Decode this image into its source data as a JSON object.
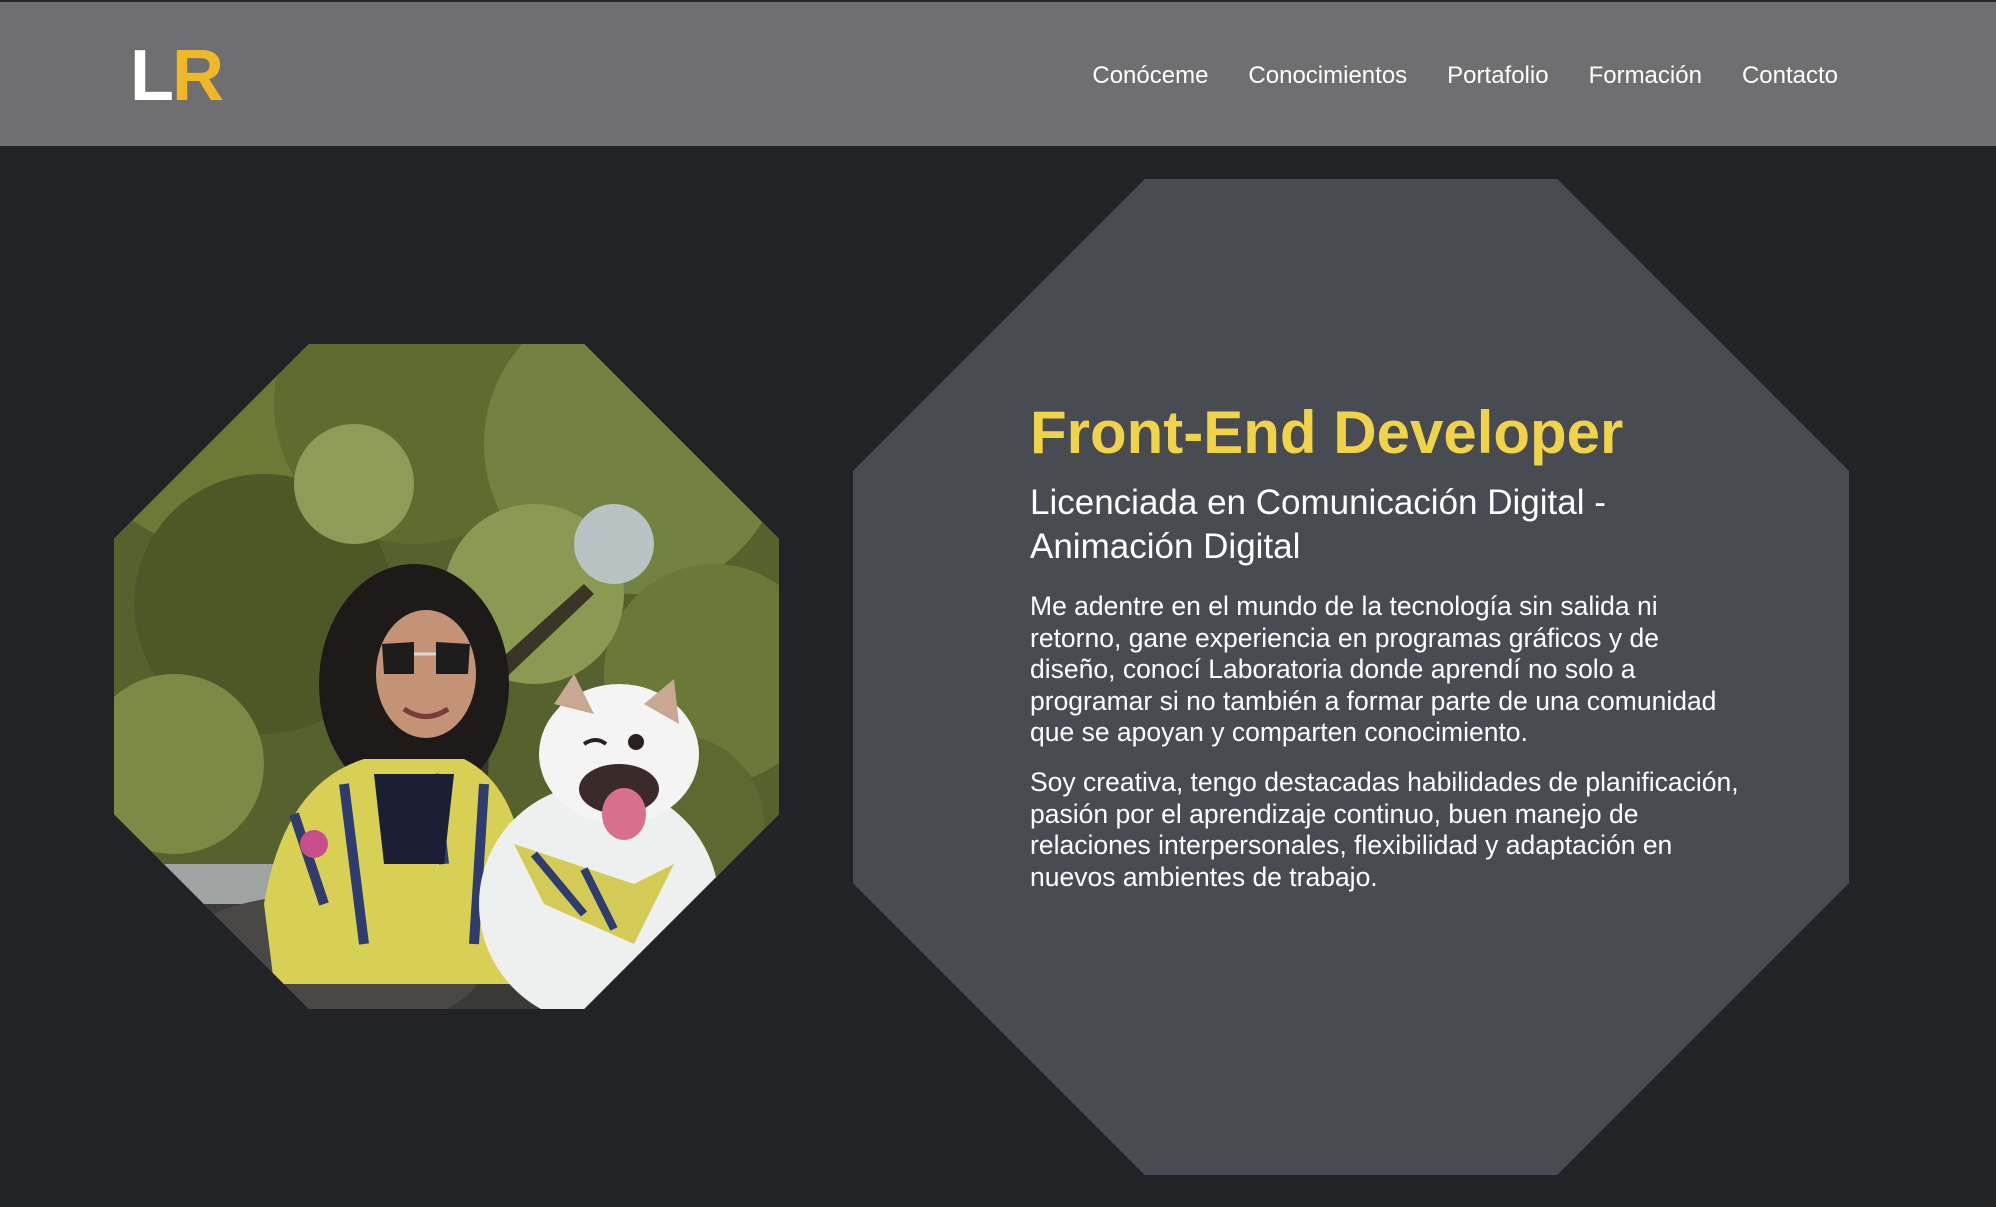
{
  "nav": {
    "logo_first": "L",
    "logo_second": "R",
    "links": [
      "Conóceme",
      "Conocimientos",
      "Portafolio",
      "Formación",
      "Contacto"
    ]
  },
  "hero": {
    "title": "Front-End Developer",
    "subtitle": "Licenciada en Comunicación Digital - Animación Digital",
    "paragraphs": [
      "Me adentre en el mundo de la tecnología sin salida ni retorno, gane experiencia en programas gráficos y de diseño, conocí Laboratoria donde aprendí no solo a programar si no también a formar parte de una comunidad que se apoyan y comparten conocimiento.",
      "Soy creativa, tengo destacadas habilidades de planificación, pasión por el aprendizaje continuo, buen manejo de relaciones interpersonales, flexibilidad y adaptación en nuevos ambientes de trabajo."
    ]
  },
  "colors": {
    "page_background": "#222327",
    "navbar_background": "#6f6f72",
    "panel_background": "#494b53",
    "accent_yellow": "#f1d34a",
    "logo_accent": "#f0b829",
    "text": "#ffffff"
  }
}
